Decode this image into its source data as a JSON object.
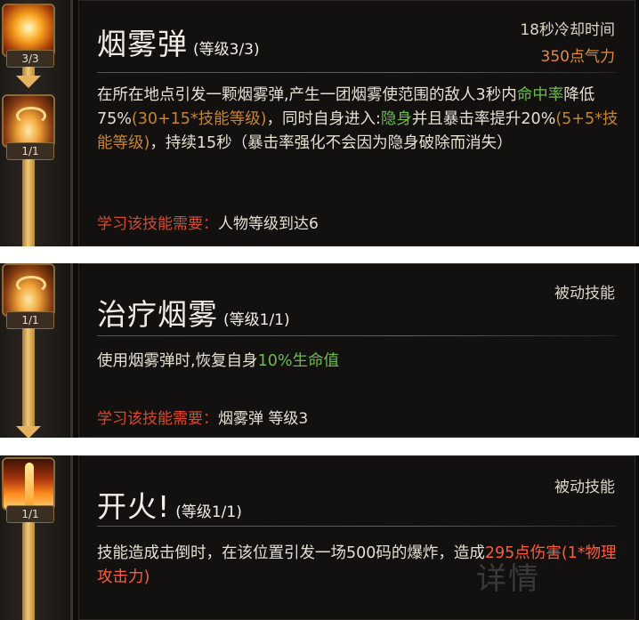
{
  "skills": [
    {
      "title": "烟雾弹",
      "level": "(等级3/3)",
      "cooldown": "18秒冷却时间",
      "cost": "350点气力",
      "icon_levels": [
        "3/3",
        "1/1"
      ],
      "desc": {
        "a": "在所在地点引发一颗烟雾弹,产生一团烟雾使范围的敌人3秒内",
        "b": "命中率",
        "c": "降低75%",
        "d": "(30+15*技能等级)",
        "e": "，同时自身进入:",
        "f": "隐身",
        "g": "并且暴击率提升20%",
        "h": "(5+5*技能等级)",
        "i": "，持续15秒（暴击率强化不会因为隐身破除而消失）"
      },
      "req_label": "学习该技能需要：",
      "req_value": "人物等级到达6",
      "icon_name": "smoke-bomb-icon"
    },
    {
      "title": "治疗烟雾",
      "level": "(等级1/1)",
      "tag": "被动技能",
      "icon_levels": [
        "1/1"
      ],
      "desc": {
        "a": "使用烟雾弹时,恢复自身",
        "b": "10%生命值"
      },
      "req_label": "学习该技能需要：",
      "req_value": "烟雾弹 等级3",
      "icon_name": "healing-smoke-icon"
    },
    {
      "title": "开火!",
      "level": "(等级1/1)",
      "tag": "被动技能",
      "icon_levels": [
        "1/1"
      ],
      "desc": {
        "a": "技能造成击倒时，在该位置引发一场500码的爆炸，造成",
        "b": "295点伤害",
        "c": "(1*物理攻击力)"
      },
      "watermark": "详情",
      "icon_name": "fire-explosion-icon"
    }
  ],
  "colors": {
    "green": "#6fbb4e",
    "orange": "#c8842c",
    "red": "#ff5a3a",
    "cost": "#e48a3a",
    "req_label": "#d84a2a"
  }
}
